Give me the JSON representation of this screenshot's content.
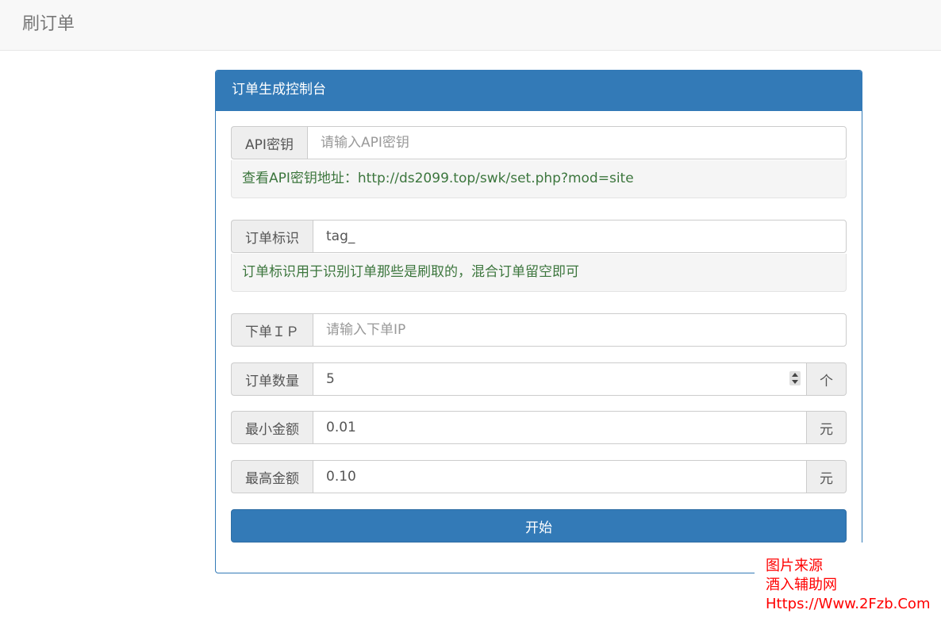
{
  "navbar": {
    "brand": "刷订单"
  },
  "panel": {
    "title": "订单生成控制台"
  },
  "form": {
    "api_key": {
      "label": "API密钥",
      "value": "",
      "placeholder": "请输入API密钥"
    },
    "api_help": "查看API密钥地址：http://ds2099.top/swk/set.php?mod=site",
    "order_tag": {
      "label": "订单标识",
      "value": "tag_"
    },
    "tag_help": "订单标识用于识别订单那些是刷取的，混合订单留空即可",
    "order_ip": {
      "label": "下单ＩＰ",
      "value": "",
      "placeholder": "请输入下单IP"
    },
    "order_count": {
      "label": "订单数量",
      "value": "5",
      "unit": "个"
    },
    "min_amount": {
      "label": "最小金额",
      "value": "0.01",
      "unit": "元"
    },
    "max_amount": {
      "label": "最高金额",
      "value": "0.10",
      "unit": "元"
    },
    "start_label": "开始"
  },
  "watermark": {
    "line1": "图片来源",
    "line2": "酒入辅助网",
    "line3": "Https://Www.2Fzb.Com"
  },
  "colors": {
    "primary": "#337ab7",
    "help_text": "#3c763d",
    "watermark": "#ff0000"
  }
}
